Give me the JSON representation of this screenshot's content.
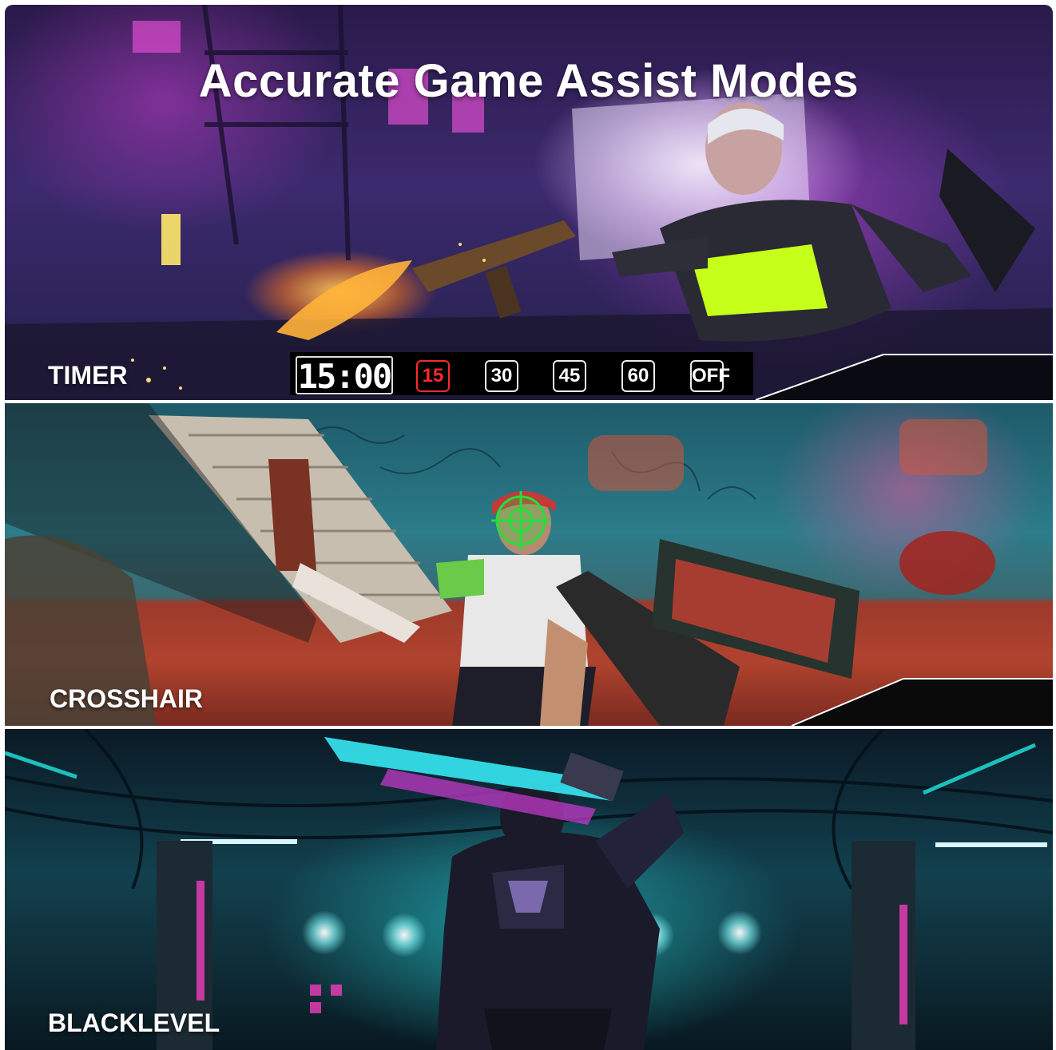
{
  "headline": "Accurate Game Assist Modes",
  "sections": {
    "timer": {
      "label": "TIMER"
    },
    "crosshair": {
      "label": "CROSSHAIR"
    },
    "blacklevel": {
      "label": "BLACKLEVEL"
    }
  },
  "timer": {
    "readout": "15:00",
    "presets": [
      {
        "label": "15",
        "active": true
      },
      {
        "label": "30",
        "active": false
      },
      {
        "label": "45",
        "active": false
      },
      {
        "label": "60",
        "active": false
      },
      {
        "label": "OFF",
        "active": false
      }
    ]
  },
  "colors": {
    "active_preset": "#ff2a2a",
    "crosshair": "#22e03a",
    "label_text": "#ffffff"
  },
  "icons": [
    "crosshair-icon"
  ]
}
